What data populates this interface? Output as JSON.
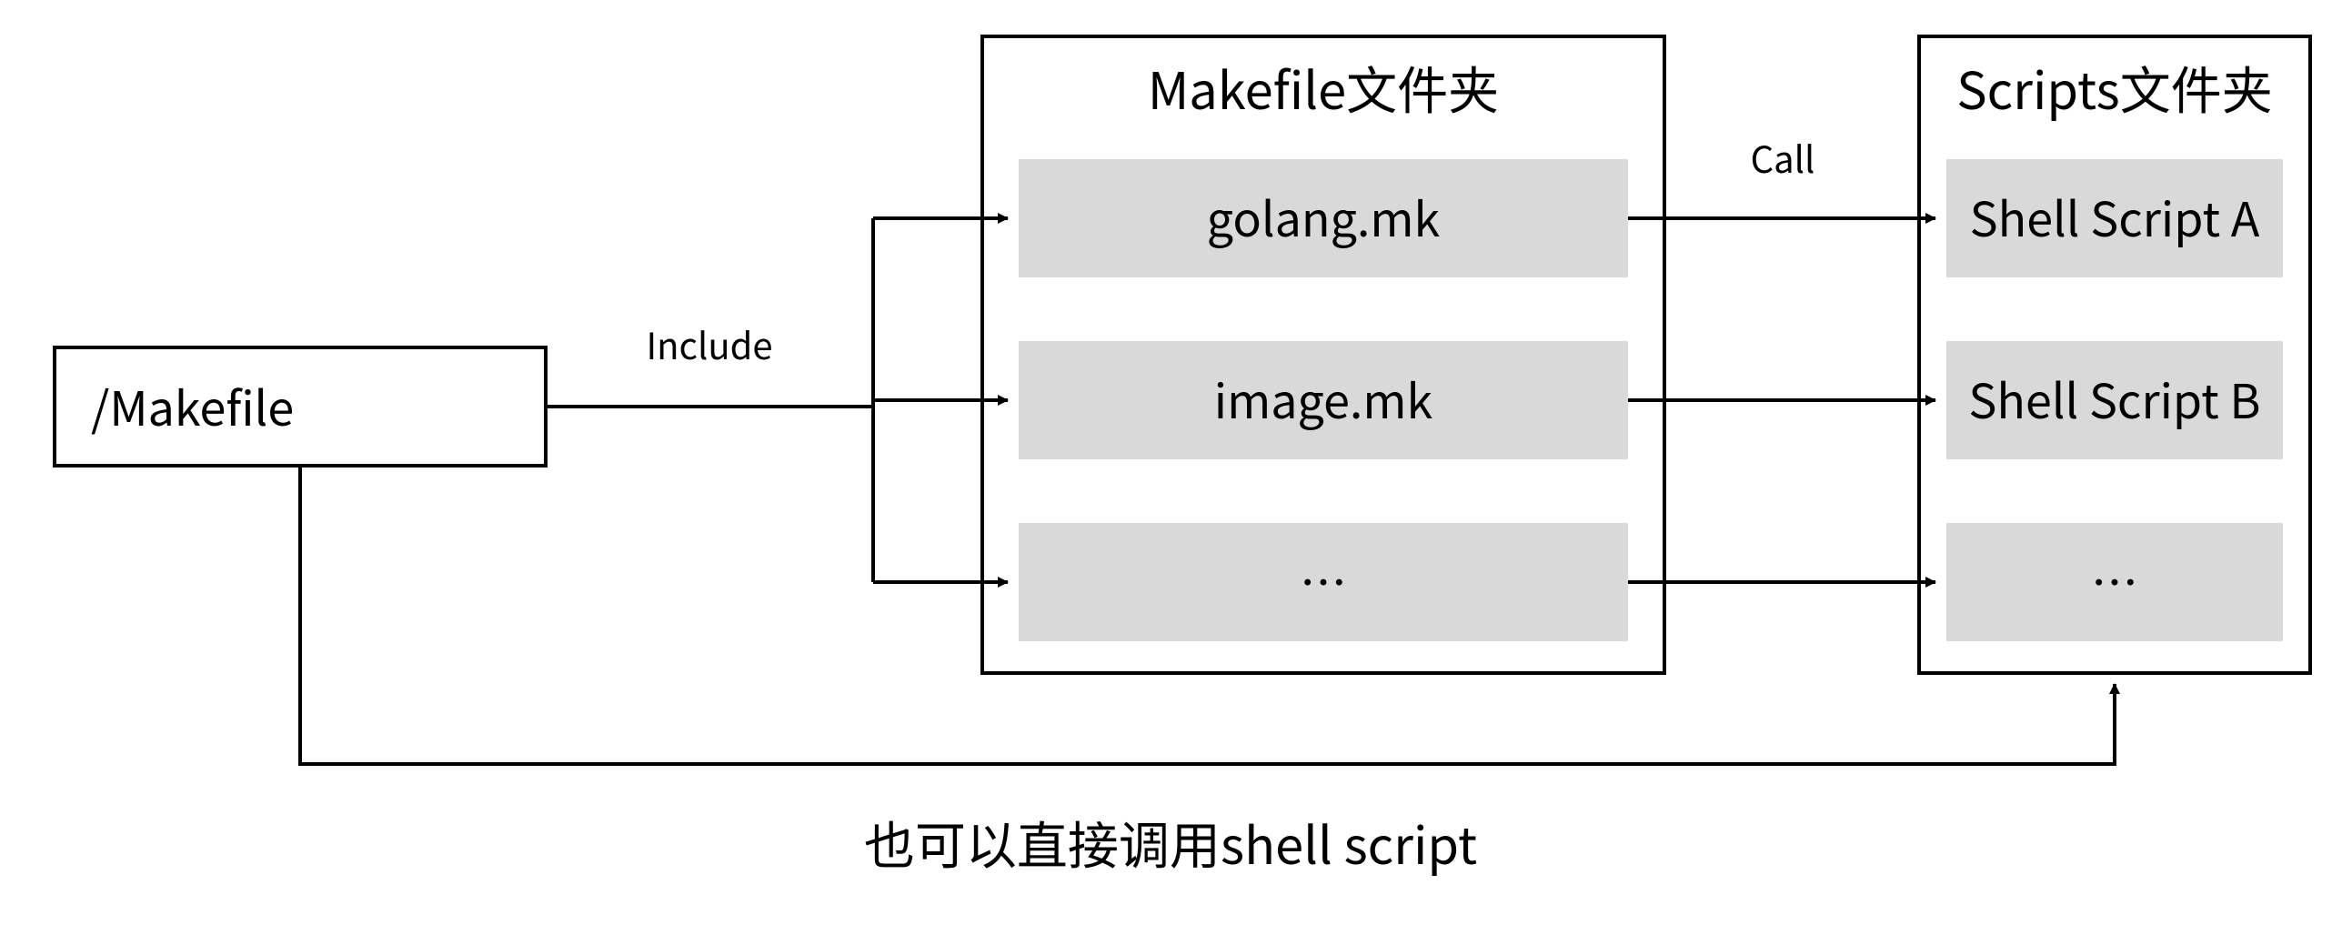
{
  "root": {
    "label": "/Makefile"
  },
  "makefileFolder": {
    "title": "Makefile文件夹",
    "items": [
      "golang.mk",
      "image.mk",
      "…"
    ]
  },
  "scriptsFolder": {
    "title": "Scripts文件夹",
    "items": [
      "Shell Script A",
      "Shell Script B",
      "…"
    ]
  },
  "edges": {
    "include": "Include",
    "call": "Call"
  },
  "caption": "也可以直接调用shell script"
}
